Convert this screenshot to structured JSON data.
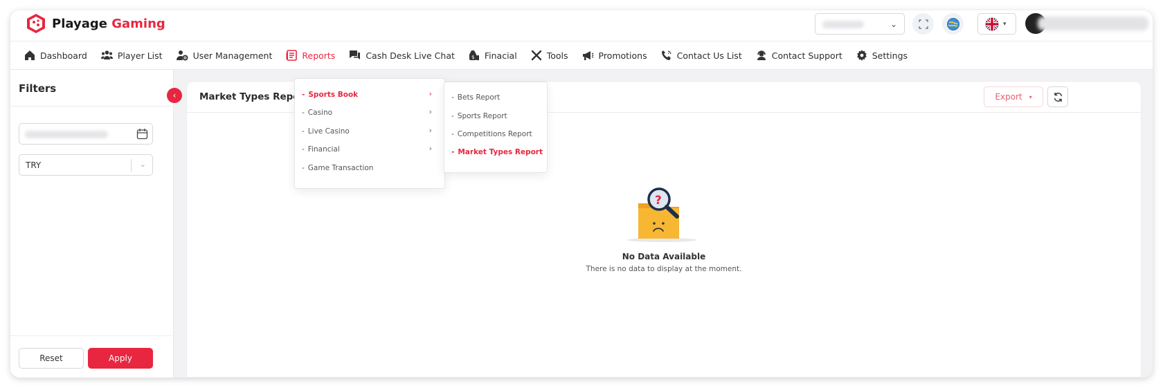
{
  "app": {
    "brand_main": "Playage",
    "brand_accent": "Gaming",
    "accent_color": "#e8263f"
  },
  "header": {
    "fullscreen_icon": "expand-icon",
    "globe_icon": "globe-icon",
    "language_flag": "uk-flag-icon",
    "caret": "▾"
  },
  "nav": {
    "items": [
      {
        "label": "Dashboard",
        "icon": "home-icon"
      },
      {
        "label": "Player List",
        "icon": "users-icon"
      },
      {
        "label": "User Management",
        "icon": "user-gear-icon"
      },
      {
        "label": "Reports",
        "icon": "report-icon"
      },
      {
        "label": "Cash Desk Live Chat",
        "icon": "chat-icon"
      },
      {
        "label": "Finacial",
        "icon": "money-icon"
      },
      {
        "label": "Tools",
        "icon": "tools-icon"
      },
      {
        "label": "Promotions",
        "icon": "megaphone-icon"
      },
      {
        "label": "Contact Us List",
        "icon": "phone-icon"
      },
      {
        "label": "Contact Support",
        "icon": "support-icon"
      },
      {
        "label": "Settings",
        "icon": "gear-icon"
      }
    ]
  },
  "filters": {
    "title": "Filters",
    "currency_value": "TRY",
    "reset_label": "Reset",
    "apply_label": "Apply"
  },
  "reports_menu": {
    "items": [
      {
        "label": "Sports Book",
        "has_sub": true,
        "active": true
      },
      {
        "label": "Casino",
        "has_sub": true
      },
      {
        "label": "Live Casino",
        "has_sub": true
      },
      {
        "label": "Financial",
        "has_sub": true
      },
      {
        "label": "Game Transaction",
        "has_sub": false
      }
    ]
  },
  "sports_menu": {
    "items": [
      {
        "label": "Bets Report"
      },
      {
        "label": "Sports Report"
      },
      {
        "label": "Competitions Report"
      },
      {
        "label": "Market Types Report",
        "active": true
      }
    ]
  },
  "main": {
    "title": "Market Types Report",
    "export_label": "Export",
    "empty_title": "No Data Available",
    "empty_subtitle": "There is no data to display at the moment."
  }
}
